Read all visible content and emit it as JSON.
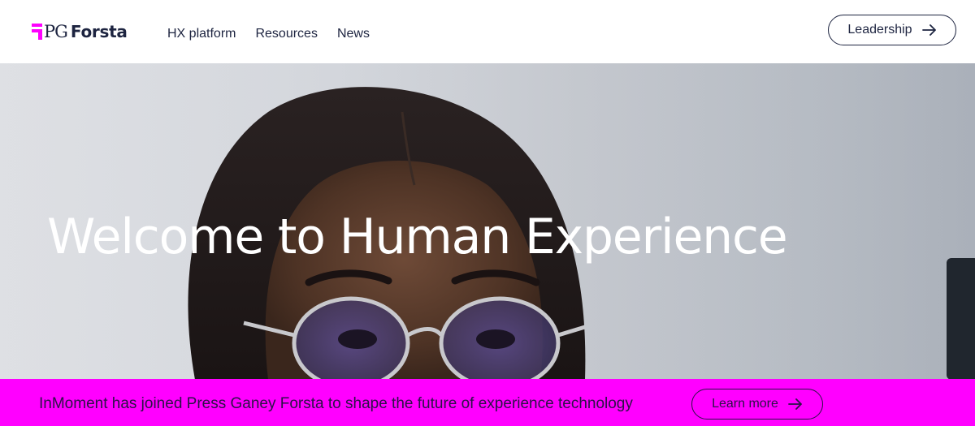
{
  "header": {
    "logo_pg": "PG",
    "logo_forsta": "Forsta",
    "nav": [
      "HX platform",
      "Resources",
      "News"
    ],
    "leadership_label": "Leadership"
  },
  "hero": {
    "title": "Welcome to Human Experience"
  },
  "banner": {
    "text": "InMoment has joined Press Ganey Forsta to shape the future of experience technology",
    "button_label": "Learn more"
  },
  "colors": {
    "brand_magenta": "#ff00ff",
    "text_navy": "#1d2440",
    "banner_text": "#2b1247"
  },
  "icons": {
    "logo_mark": "pg-forsta-logo-mark-icon",
    "arrow": "arrow-right-icon"
  }
}
